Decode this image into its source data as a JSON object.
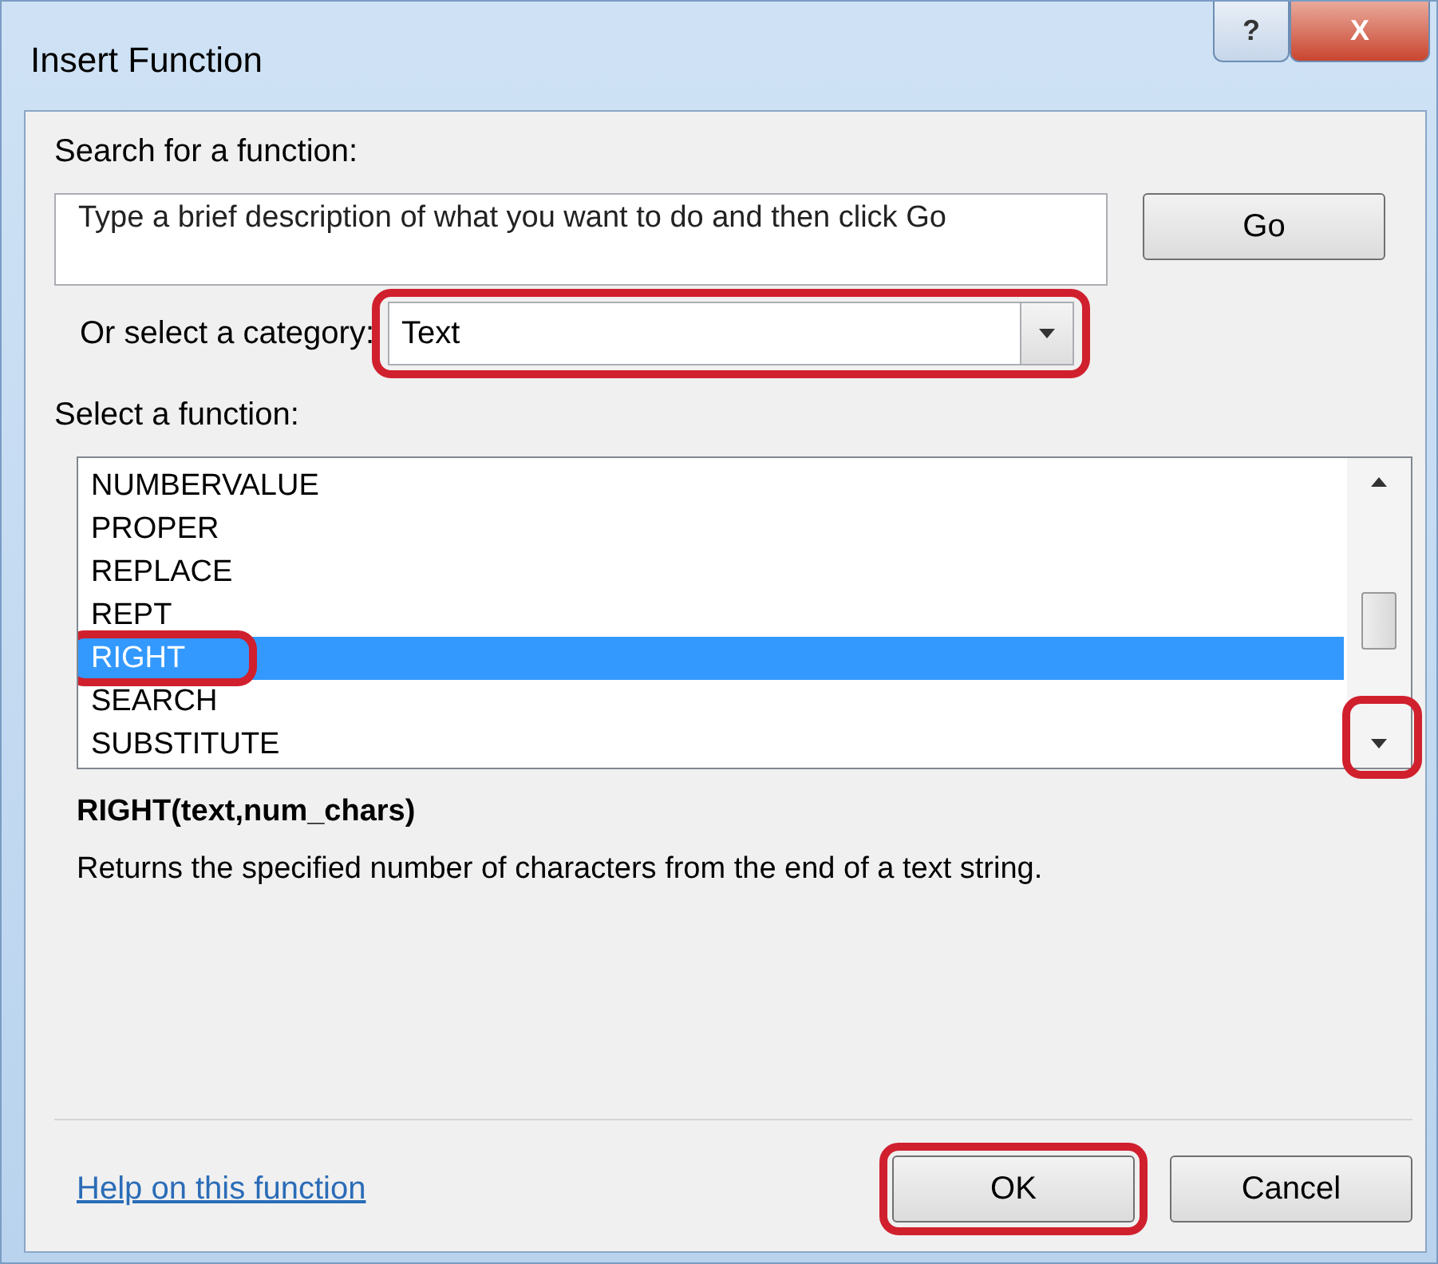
{
  "window": {
    "title": "Insert Function",
    "help_button": "?",
    "close_button": "X"
  },
  "search": {
    "label": "Search for a function:",
    "placeholder": "Type a brief description of what you want to do and then click Go",
    "go_button": "Go"
  },
  "category": {
    "label": "Or select a category:",
    "value": "Text",
    "circled": true
  },
  "functions": {
    "label": "Select a function:",
    "scroll_down_circled": true,
    "items": [
      {
        "name": "NUMBERVALUE",
        "selected": false,
        "circled": false
      },
      {
        "name": "PROPER",
        "selected": false,
        "circled": false
      },
      {
        "name": "REPLACE",
        "selected": false,
        "circled": false
      },
      {
        "name": "REPT",
        "selected": false,
        "circled": false
      },
      {
        "name": "RIGHT",
        "selected": true,
        "circled": true
      },
      {
        "name": "SEARCH",
        "selected": false,
        "circled": false
      },
      {
        "name": "SUBSTITUTE",
        "selected": false,
        "circled": false
      }
    ]
  },
  "signature": "RIGHT(text,num_chars)",
  "description": "Returns the specified number of characters from the end of a text string.",
  "footer": {
    "help_link": "Help on this function",
    "buttons": [
      {
        "label": "OK",
        "circled": true
      },
      {
        "label": "Cancel",
        "circled": false
      }
    ]
  }
}
